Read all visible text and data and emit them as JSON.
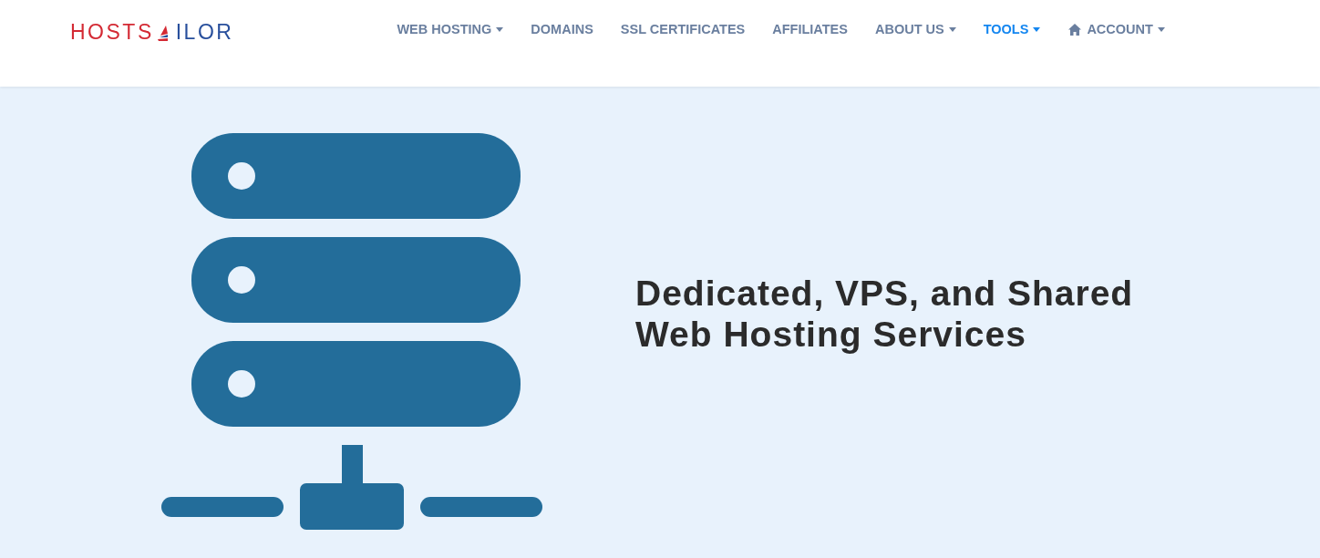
{
  "logo": {
    "first": "HOSTS",
    "last": "ILOR"
  },
  "nav": [
    {
      "label": "WEB HOSTING",
      "dropdown": true,
      "selected": false,
      "kind": "text"
    },
    {
      "label": "DOMAINS",
      "dropdown": false,
      "selected": false,
      "kind": "text"
    },
    {
      "label": "SSL CERTIFICATES",
      "dropdown": false,
      "selected": false,
      "kind": "text"
    },
    {
      "label": "AFFILIATES",
      "dropdown": false,
      "selected": false,
      "kind": "text"
    },
    {
      "label": "ABOUT US",
      "dropdown": true,
      "selected": false,
      "kind": "text"
    },
    {
      "label": "TOOLS",
      "dropdown": true,
      "selected": true,
      "kind": "text"
    },
    {
      "label": "ACCOUNT",
      "dropdown": true,
      "selected": false,
      "kind": "home"
    }
  ],
  "hero": {
    "heading": "Dedicated, VPS, and Shared Web Hosting Services"
  }
}
